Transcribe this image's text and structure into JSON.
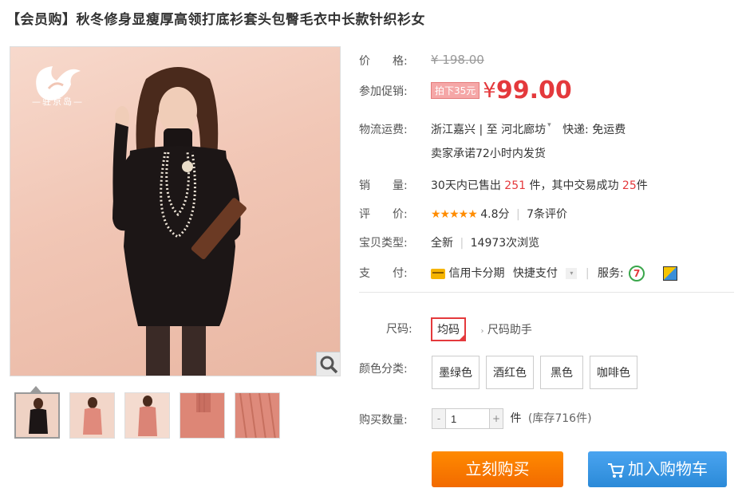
{
  "title": "【会员购】秋冬修身显瘦厚高领打底衫套头包臀毛衣中长款针织衫女",
  "gallery": {
    "logo_text": "—驻京岛—",
    "zoom_icon": "magnifier-icon",
    "thumbnails": [
      "black-dress",
      "pink-dress-front",
      "pink-dress-back",
      "pink-collar-detail",
      "pink-knit-texture"
    ]
  },
  "price": {
    "label": "价　　格:",
    "original": "¥ 198.00"
  },
  "promo": {
    "label": "参加促销:",
    "tag": "拍下35元",
    "currency": "¥",
    "price": "99.00"
  },
  "shipping": {
    "label": "物流运费:",
    "from": "浙江嘉兴 | 至",
    "to": "河北廊坊",
    "express": "快递: 免运费",
    "promise": "卖家承诺72小时内发货"
  },
  "sales": {
    "label": "销　　量:",
    "prefix": "30天内已售出",
    "sold": "251",
    "mid": "件，其中交易成功",
    "success": "25",
    "suffix": "件"
  },
  "rating": {
    "label": "评　　价:",
    "stars": "★★★★★",
    "score": "4.8分",
    "count": "7条评价"
  },
  "condition": {
    "label": "宝贝类型:",
    "type": "全新",
    "views": "14973次浏览"
  },
  "payment": {
    "label": "支　　付:",
    "credit": "信用卡分期",
    "quick": "快捷支付",
    "service_label": "服务:"
  },
  "size": {
    "label": "尺码:",
    "option": "均码",
    "helper": "尺码助手"
  },
  "colors": {
    "label": "颜色分类:",
    "options": [
      "墨绿色",
      "酒红色",
      "黑色",
      "咖啡色"
    ]
  },
  "quantity": {
    "label": "购买数量:",
    "minus": "-",
    "value": "1",
    "plus": "+",
    "unit": "件",
    "stock": "(库存716件)"
  },
  "actions": {
    "buy_now": "立刻购买",
    "add_cart": "加入购物车"
  },
  "colors_theme": {
    "price_red": "#e4393c",
    "buy_orange": "#f26a00",
    "cart_blue": "#2b8ad8"
  }
}
